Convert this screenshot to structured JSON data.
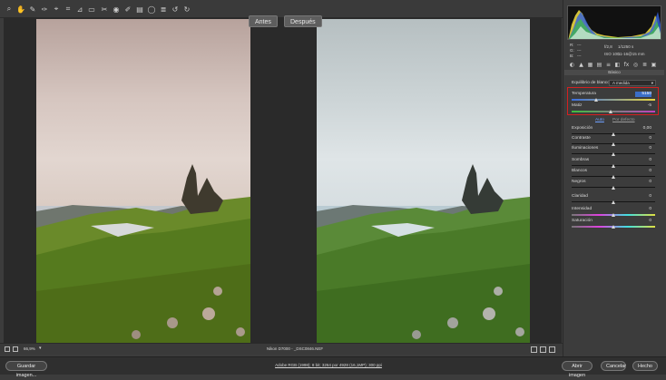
{
  "toolbar": {
    "tools": [
      {
        "name": "zoom-tool-icon",
        "glyph": "⌕"
      },
      {
        "name": "hand-tool-icon",
        "glyph": "✋"
      },
      {
        "name": "white-balance-tool-icon",
        "glyph": "✎"
      },
      {
        "name": "color-sampler-tool-icon",
        "glyph": "✑"
      },
      {
        "name": "target-adjustment-tool-icon",
        "glyph": "⌖"
      },
      {
        "name": "crop-tool-icon",
        "glyph": "⌗"
      },
      {
        "name": "straighten-tool-icon",
        "glyph": "⊿"
      },
      {
        "name": "transform-tool-icon",
        "glyph": "▭"
      },
      {
        "name": "spot-removal-tool-icon",
        "glyph": "✂"
      },
      {
        "name": "red-eye-tool-icon",
        "glyph": "◉"
      },
      {
        "name": "adjustment-brush-icon",
        "glyph": "✐"
      },
      {
        "name": "graduated-filter-icon",
        "glyph": "▤"
      },
      {
        "name": "radial-filter-icon",
        "glyph": "◯"
      },
      {
        "name": "preferences-icon",
        "glyph": "≣"
      },
      {
        "name": "rotate-left-icon",
        "glyph": "↺"
      },
      {
        "name": "rotate-right-icon",
        "glyph": "↻"
      }
    ],
    "fullscreen_icon": "⇱"
  },
  "compare_tabs": {
    "before": "Antes",
    "after": "Después"
  },
  "statusbar": {
    "zoom_value": "66,9%",
    "filename": "Nikon D7000 - _DSC0846.NEF"
  },
  "footer": {
    "save_label": "Guardar imagen...",
    "workflow_link": "Adobe RGB (1998); 8 bit; 3264 por 4928 (16,1MP); 300 ppi",
    "open_label": "Abrir imagen",
    "cancel_label": "Cancelar",
    "done_label": "Hecho"
  },
  "panel": {
    "meta": {
      "r": "R:",
      "g": "G:",
      "b": "B:",
      "dash": "---",
      "aperture": "f/2,8",
      "shutter": "1/1250 s",
      "iso": "ISO 100",
      "lens": "11-16@15 mm"
    },
    "section_title": "Básico",
    "wb_label": "Equilibrio de blancos:",
    "wb_value": "A medida",
    "auto_label": "Auto",
    "default_label": "Por defecto",
    "sliders": [
      {
        "id": "temperatura",
        "label": "Temperatura",
        "value": "5150",
        "pos": 0.3
      },
      {
        "id": "matiz",
        "label": "Matiz",
        "value": "-5",
        "pos": 0.47
      },
      {
        "id": "exposicion",
        "label": "Exposición",
        "value": "0,00",
        "pos": 0.5
      },
      {
        "id": "contraste",
        "label": "Contraste",
        "value": "0",
        "pos": 0.5
      },
      {
        "id": "iluminaciones",
        "label": "Iluminaciones",
        "value": "0",
        "pos": 0.5
      },
      {
        "id": "sombras",
        "label": "Sombras",
        "value": "0",
        "pos": 0.5
      },
      {
        "id": "blancos",
        "label": "Blancos",
        "value": "0",
        "pos": 0.5
      },
      {
        "id": "negros",
        "label": "Negros",
        "value": "0",
        "pos": 0.5
      },
      {
        "id": "claridad",
        "label": "Claridad",
        "value": "0",
        "pos": 0.5
      },
      {
        "id": "intensidad",
        "label": "Intensidad",
        "value": "0",
        "pos": 0.5
      },
      {
        "id": "saturacion",
        "label": "Saturación",
        "value": "0",
        "pos": 0.5
      }
    ]
  },
  "colors": {
    "selection_red": "#d42020",
    "temp_left": "#3b6fe0",
    "temp_right": "#e8d640",
    "tint_left": "#3fbf3f",
    "tint_right": "#c040c0"
  }
}
